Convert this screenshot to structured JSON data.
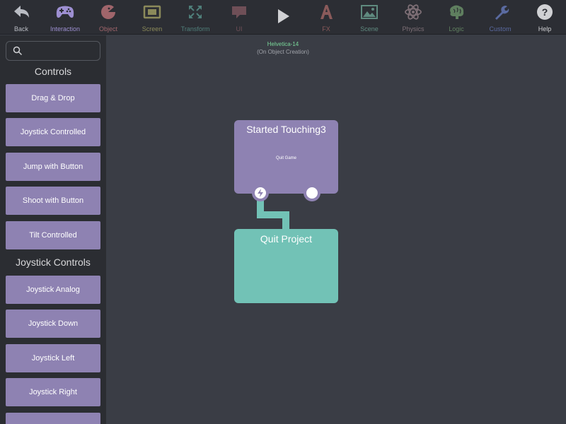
{
  "toolbar": {
    "items": [
      {
        "label": "Back",
        "icon": "back-arrow-icon",
        "color": "#b9bcc3"
      },
      {
        "label": "Interaction",
        "icon": "gamepad-icon",
        "color": "#9d8fd1"
      },
      {
        "label": "Object",
        "icon": "pacman-icon",
        "color": "#a0656b"
      },
      {
        "label": "Screen",
        "icon": "screen-icon",
        "color": "#8b8a5a"
      },
      {
        "label": "Transform",
        "icon": "transform-icon",
        "color": "#4f7f7a"
      },
      {
        "label": "UI",
        "icon": "speech-bubble-icon",
        "color": "#6f4f57"
      },
      {
        "label": "",
        "icon": "play-icon",
        "color": "#d0d1d4"
      },
      {
        "label": "FX",
        "icon": "fx-icon",
        "color": "#8a5a5a"
      },
      {
        "label": "Scene",
        "icon": "landscape-icon",
        "color": "#5f8a7f"
      },
      {
        "label": "Physics",
        "icon": "atom-icon",
        "color": "#7e6f76"
      },
      {
        "label": "Logic",
        "icon": "brain-icon",
        "color": "#5f7f5f"
      },
      {
        "label": "Custom",
        "icon": "wrench-icon",
        "color": "#5a6aa0"
      },
      {
        "label": "Help",
        "icon": "help-icon",
        "color": "#d0d1d4"
      }
    ]
  },
  "sidebar": {
    "search_placeholder": "",
    "sections": [
      {
        "title": "Controls",
        "items": [
          "Drag & Drop",
          "Joystick Controlled",
          "Jump with Button",
          "Shoot with Button",
          "Tilt Controlled"
        ]
      },
      {
        "title": "Joystick Controls",
        "items": [
          "Joystick Analog",
          "Joystick Down",
          "Joystick Left",
          "Joystick Right"
        ]
      }
    ]
  },
  "canvas": {
    "object_name": "Helvetica-14",
    "object_event": "(On Object Creation)",
    "node_trigger": {
      "title": "Started Touching3",
      "subtitle": "Quit Game",
      "color": "#8e82b2"
    },
    "node_action": {
      "title": "Quit Project",
      "color": "#72c2b6"
    }
  }
}
